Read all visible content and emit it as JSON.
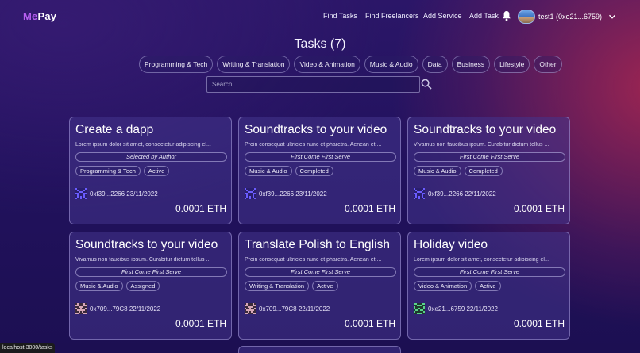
{
  "nav": {
    "logo_me": "Me",
    "logo_pay": "Pay",
    "links": [
      "Find Tasks",
      "Find Freelancers",
      "Add Service",
      "Add Task"
    ],
    "user_label": "test1 (0xe21...6759)"
  },
  "page": {
    "title": "Tasks (7)",
    "categories": [
      "Programming & Tech",
      "Writing & Translation",
      "Video & Animation",
      "Music & Audio",
      "Data",
      "Business",
      "Lifestyle",
      "Other"
    ],
    "search_placeholder": "Search..."
  },
  "cards": [
    {
      "title": "Create a dapp",
      "description": "Lorem ipsum dolor sit amet, consectetur adipiscing el...",
      "method": "Selected by Author",
      "category": "Programming & Tech",
      "status": "Active",
      "owner": "0xf39...2266 23/11/2022",
      "price": "0.0001 ETH"
    },
    {
      "title": "Soundtracks to your video",
      "description": "Proin consequat ultricies nunc et pharetra. Aenean et ...",
      "method": "First Come First Serve",
      "category": "Music & Audio",
      "status": "Completed",
      "owner": "0xf39...2266 23/11/2022",
      "price": "0.0001 ETH"
    },
    {
      "title": "Soundtracks to your video",
      "description": "Vivamus non faucibus ipsum. Curabitur dictum tellus ...",
      "method": "First Come First Serve",
      "category": "Music & Audio",
      "status": "Completed",
      "owner": "0xf39...2266 22/11/2022",
      "price": "0.0001 ETH"
    },
    {
      "title": "Soundtracks to your video",
      "description": "Vivamus non faucibus ipsum. Curabitur dictum tellus ...",
      "method": "First Come First Serve",
      "category": "Music & Audio",
      "status": "Assigned",
      "owner": "0x709...79C8 22/11/2022",
      "price": "0.0001 ETH"
    },
    {
      "title": "Translate Polish to English",
      "description": "Proin consequat ultricies nunc et pharetra. Aenean et ...",
      "method": "First Come First Serve",
      "category": "Writing & Translation",
      "status": "Active",
      "owner": "0x709...79C8 22/11/2022",
      "price": "0.0001 ETH"
    },
    {
      "title": "Holiday video",
      "description": "Lorem ipsum dolor sit amet, consectetur adipiscing el...",
      "method": "First Come First Serve",
      "category": "Video & Animation",
      "status": "Active",
      "owner": "0xe21...6759 22/11/2022",
      "price": "0.0001 ETH"
    }
  ],
  "status_bar": "localhost:3000/tasks",
  "colors": {
    "logo_accent": "#b860f2",
    "background_top": "#2b1668",
    "background_glow": "#b2284e"
  }
}
